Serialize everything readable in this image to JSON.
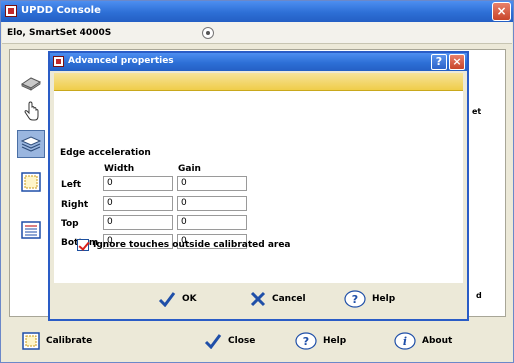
{
  "main_window": {
    "title": "UPDD Console",
    "close_label": "×",
    "device": {
      "name": "Elo, SmartSet 4000S"
    },
    "peek": {
      "right_text_1": "et",
      "right_text_2": "d"
    },
    "footer": {
      "calibrate": "Calibrate",
      "close": "Close",
      "help": "Help",
      "about": "About"
    }
  },
  "dialog": {
    "title": "Advanced properties",
    "help_label": "?",
    "close_label": "×",
    "group_title": "Edge acceleration",
    "columns": {
      "width": "Width",
      "gain": "Gain"
    },
    "rows": [
      {
        "label": "Left",
        "width": "0",
        "gain": "0"
      },
      {
        "label": "Right",
        "width": "0",
        "gain": "0"
      },
      {
        "label": "Top",
        "width": "0",
        "gain": "0"
      },
      {
        "label": "Bottom",
        "width": "0",
        "gain": "0"
      }
    ],
    "ignore_touches": {
      "label": "Ignore touches outside calibrated area",
      "checked": true
    },
    "buttons": {
      "ok": "OK",
      "cancel": "Cancel",
      "help": "Help"
    }
  },
  "colors": {
    "titlebar": "#2d6fd6",
    "highlight_strip": "#f0cd4a",
    "accent_red": "#d9201a",
    "accent_blue": "#1f4fa8"
  },
  "icons": [
    "device-settings-icon",
    "hand-pointer-icon",
    "layers-icon",
    "calibration-target-icon",
    "list-icon",
    "check-icon",
    "x-icon",
    "help-icon",
    "info-icon"
  ]
}
